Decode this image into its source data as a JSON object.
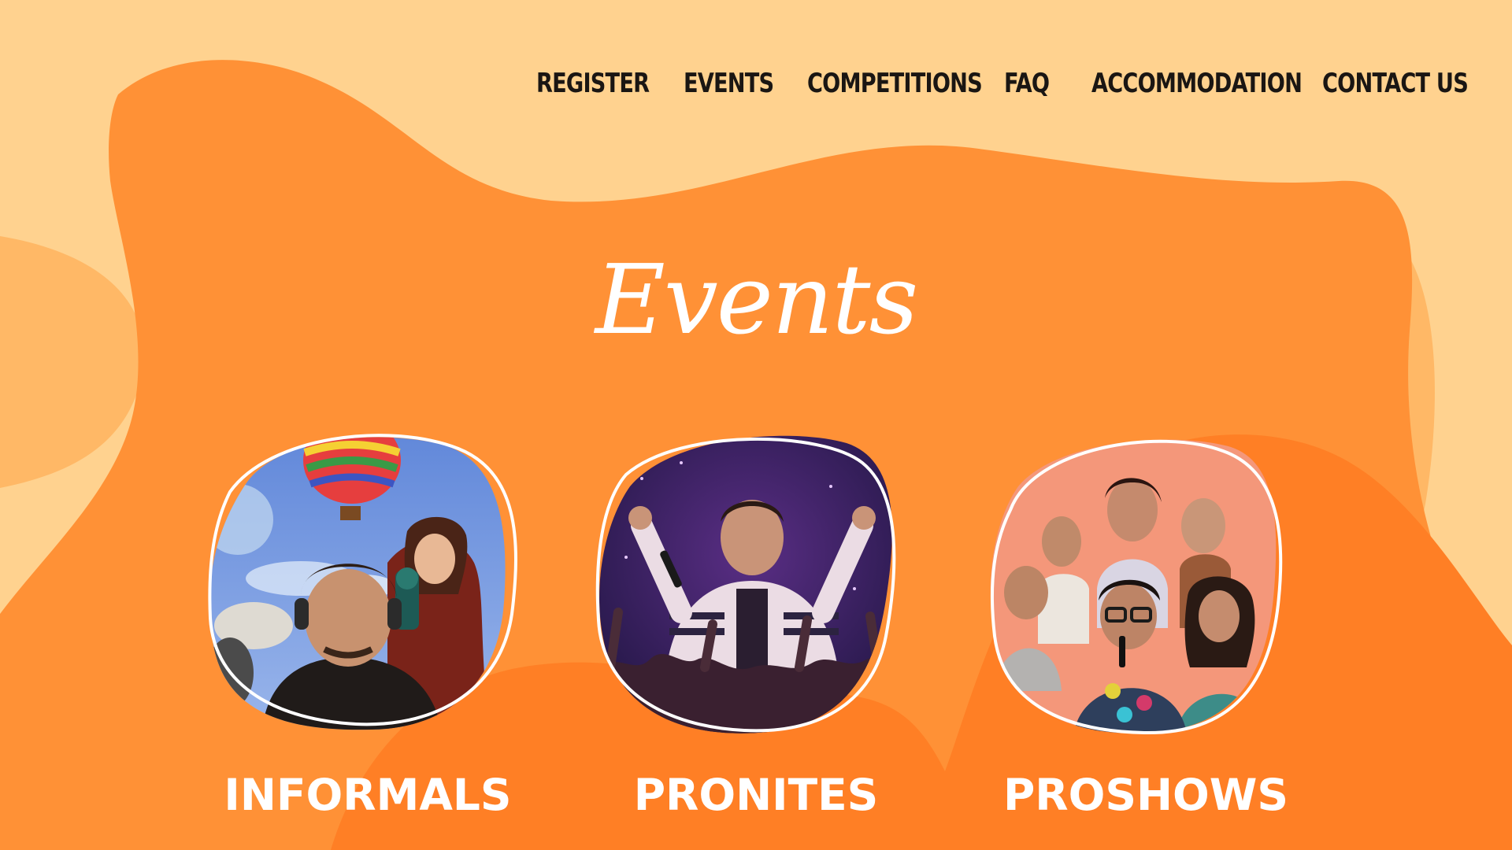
{
  "nav": {
    "items": [
      {
        "label": "REGISTER"
      },
      {
        "label": "EVENTS"
      },
      {
        "label": "COMPETITIONS"
      },
      {
        "label": "FAQ"
      },
      {
        "label": "ACCOMMODATION"
      },
      {
        "label": "CONTACT US"
      }
    ]
  },
  "page": {
    "heading": "Events"
  },
  "events": [
    {
      "label": "INFORMALS",
      "image": "informals-collage"
    },
    {
      "label": "PRONITES",
      "image": "pronites-performer"
    },
    {
      "label": "PROSHOWS",
      "image": "proshows-collage"
    }
  ],
  "colors": {
    "background": "#FFD28F",
    "blob_mid": "#FFB866",
    "blob_main": "#FF9136",
    "blob_front": "#FF7F25",
    "text_dark": "#1A1613",
    "text_light": "#FFFFFF"
  }
}
